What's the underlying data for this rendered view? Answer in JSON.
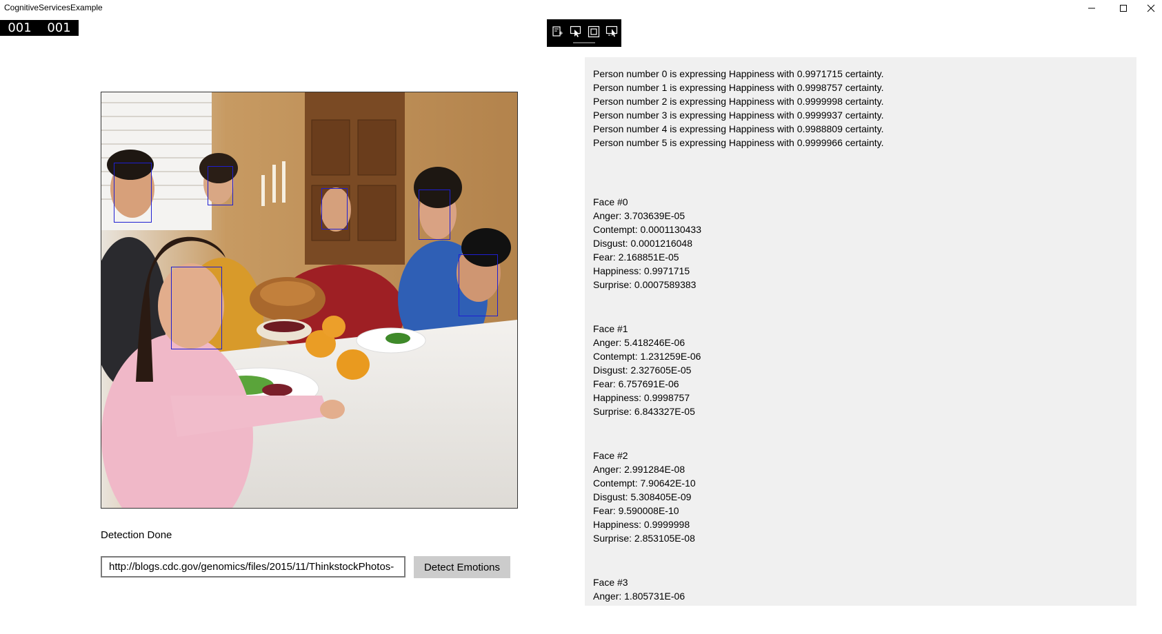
{
  "window": {
    "title": "CognitiveServicesExample"
  },
  "frame_counter": {
    "left": "001",
    "right": "001"
  },
  "debug_toolbar": {
    "icons": [
      "live-visual-tree-icon",
      "select-element-icon",
      "display-layout-adorners-icon",
      "track-focused-element-icon"
    ]
  },
  "status": {
    "text": "Detection Done"
  },
  "url_input": {
    "value": "http://blogs.cdc.gov/genomics/files/2015/11/ThinkstockPhotos-"
  },
  "detect_button": {
    "label": "Detect Emotions"
  },
  "summary": [
    "Person number 0 is expressing Happiness with 0.9971715 certainty.",
    "Person number 1 is expressing Happiness with 0.9998757 certainty.",
    "Person number 2 is expressing Happiness with 0.9999998 certainty.",
    "Person number 3 is expressing Happiness with 0.9999937 certainty.",
    "Person number 4 is expressing Happiness with 0.9988809 certainty.",
    "Person number 5 is expressing Happiness with 0.9999966 certainty."
  ],
  "faces": [
    {
      "header": "Face #0",
      "lines": [
        "Anger: 3.703639E-05",
        "Contempt: 0.0001130433",
        "Disgust: 0.0001216048",
        "Fear: 2.168851E-05",
        "Happiness: 0.9971715",
        "Surprise: 0.0007589383"
      ]
    },
    {
      "header": "Face #1",
      "lines": [
        "Anger: 5.418246E-06",
        "Contempt: 1.231259E-06",
        "Disgust: 2.327605E-05",
        "Fear: 6.757691E-06",
        "Happiness: 0.9998757",
        "Surprise: 6.843327E-05"
      ]
    },
    {
      "header": "Face #2",
      "lines": [
        "Anger: 2.991284E-08",
        "Contempt: 7.90642E-10",
        "Disgust: 5.308405E-09",
        "Fear: 9.590008E-10",
        "Happiness: 0.9999998",
        "Surprise: 2.853105E-08"
      ]
    },
    {
      "header": "Face #3",
      "lines": [
        "Anger: 1.805731E-06"
      ]
    }
  ],
  "colors": {
    "face_box": "#1e1ed2",
    "panel_bg": "#f0f0f0",
    "button_bg": "#cccccc"
  }
}
